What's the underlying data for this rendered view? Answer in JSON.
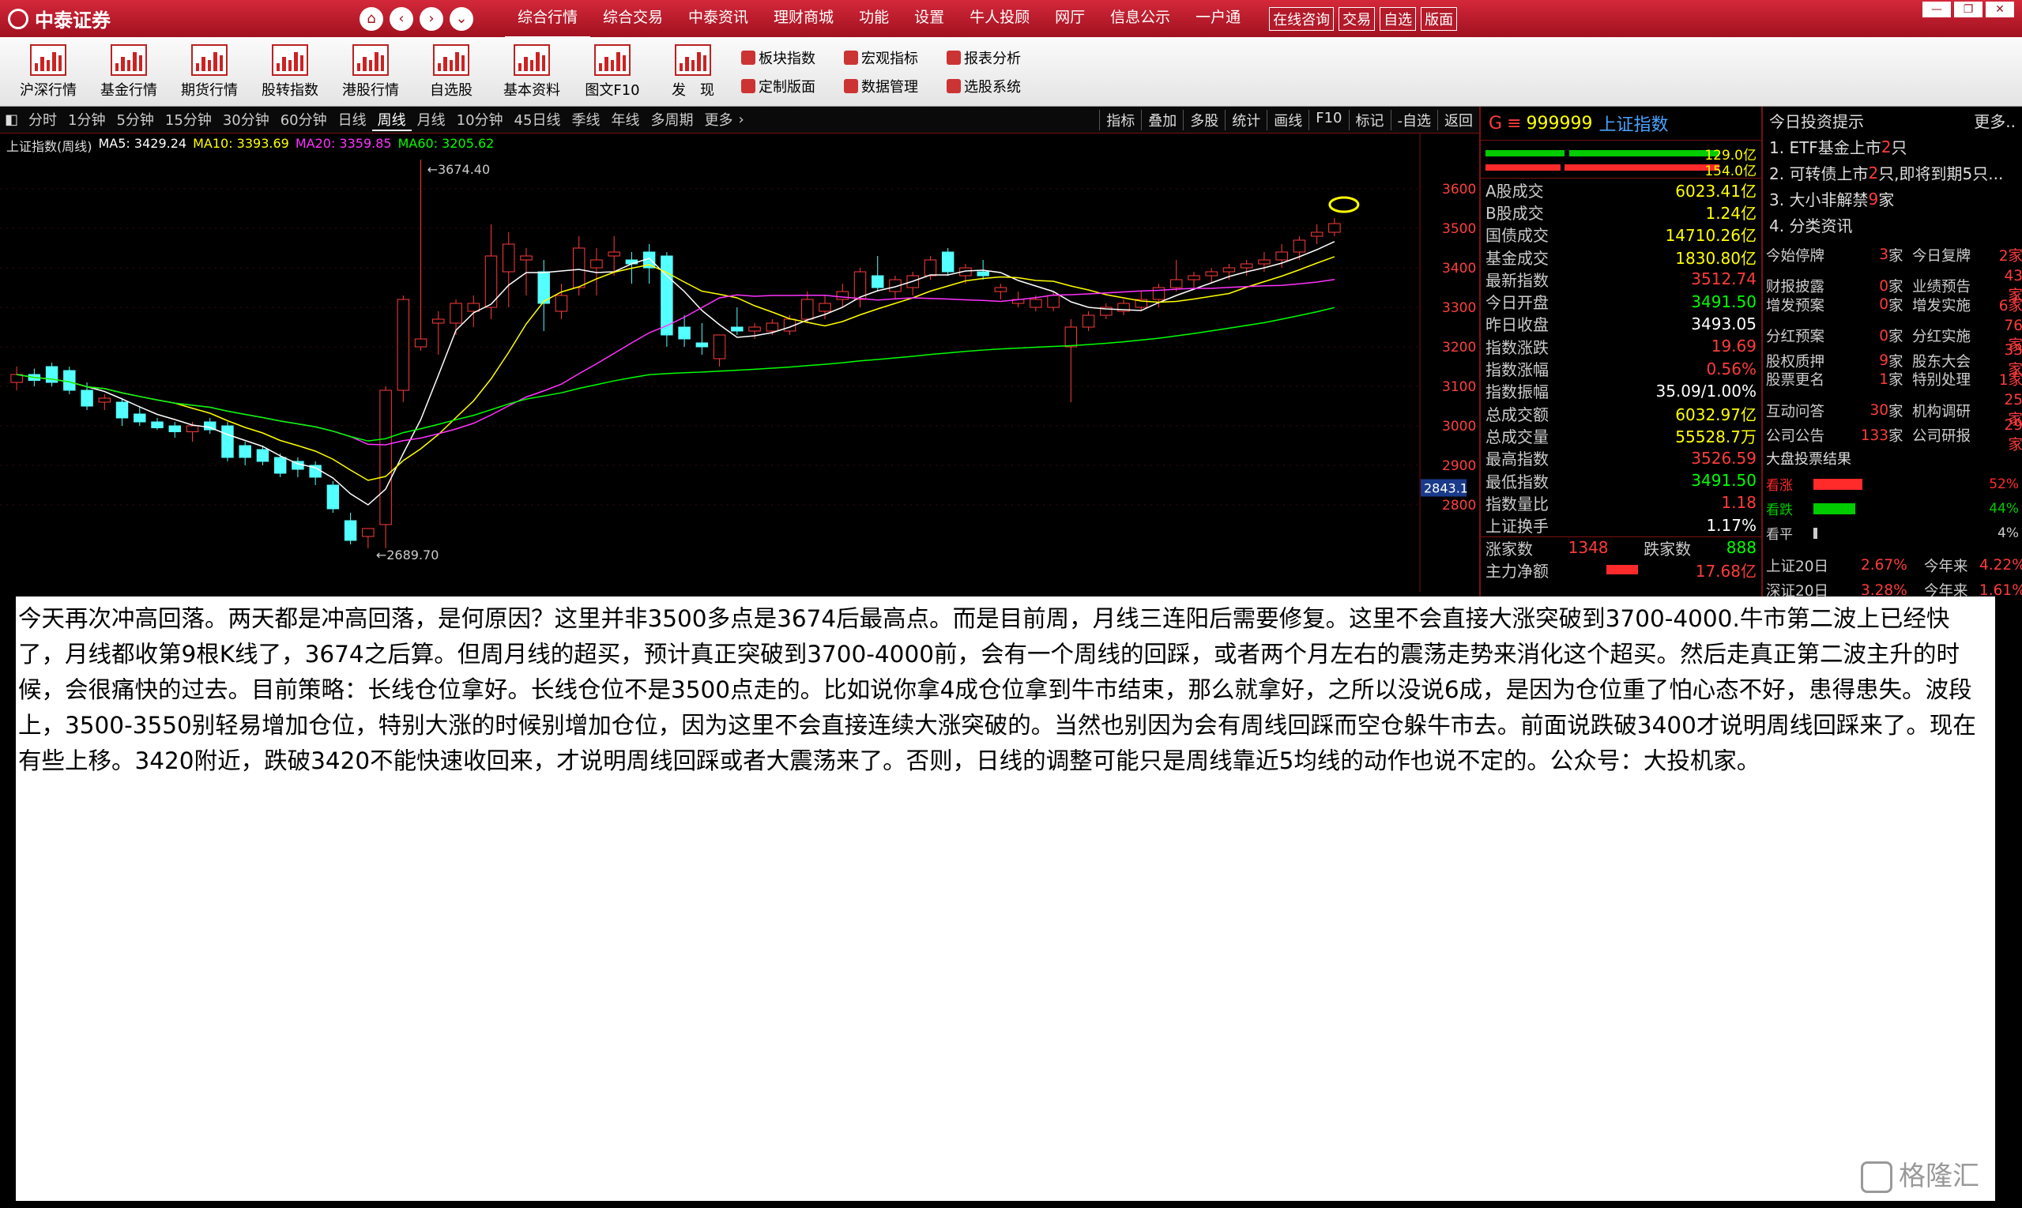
{
  "app": {
    "name": "中泰证券"
  },
  "nav_icons": [
    "home-icon",
    "back-icon",
    "forward-icon",
    "dropdown-icon"
  ],
  "top_menu": [
    "综合行情",
    "综合交易",
    "中泰资讯",
    "理财商城",
    "功能",
    "设置",
    "牛人投顾",
    "网厅",
    "信息公示",
    "一户通"
  ],
  "top_buttons": [
    "在线咨询",
    "交易",
    "自选",
    "版面"
  ],
  "toolbar": {
    "items": [
      "沪深行情",
      "基金行情",
      "期货行情",
      "股转指数",
      "港股行情",
      "自选股",
      "基本资料",
      "图文F10",
      "发　现"
    ],
    "grid": [
      "板块指数",
      "宏观指标",
      "报表分析",
      "定制版面",
      "数据管理",
      "选股系统"
    ]
  },
  "periods": [
    "分时",
    "1分钟",
    "5分钟",
    "15分钟",
    "30分钟",
    "60分钟",
    "日线",
    "周线",
    "月线",
    "10分钟",
    "45日线",
    "季线",
    "年线",
    "多周期",
    "更多"
  ],
  "active_period": "周线",
  "chart_tools": [
    "指标",
    "叠加",
    "多股",
    "统计",
    "画线",
    "F10",
    "标记",
    "-自选",
    "返回"
  ],
  "chart_header": {
    "name": "上证指数(周线)",
    "ma5": "MA5: 3429.24",
    "ma10": "MA10: 3393.69",
    "ma20": "MA20: 3359.85",
    "ma60": "MA60: 3205.62"
  },
  "price_axis": [
    "3600",
    "3500",
    "3400",
    "3300",
    "3200",
    "3100",
    "3000",
    "2900",
    "2800"
  ],
  "price_marker": "2843.1",
  "high_label": "3674.40",
  "low_label": "2689.70",
  "quote": {
    "code": "999999",
    "name": "上证指数",
    "buy_val": "129.0亿",
    "sell_val": "154.0亿",
    "rows": [
      {
        "k": "A股成交",
        "v": "6023.41亿",
        "c": "#ffff00"
      },
      {
        "k": "B股成交",
        "v": "1.24亿",
        "c": "#ffff00"
      },
      {
        "k": "国债成交",
        "v": "14710.26亿",
        "c": "#ffff00"
      },
      {
        "k": "基金成交",
        "v": "1830.80亿",
        "c": "#ffff00"
      },
      {
        "k": "最新指数",
        "v": "3512.74",
        "c": "#ff3b3b"
      },
      {
        "k": "今日开盘",
        "v": "3491.50",
        "c": "#00ff00"
      },
      {
        "k": "昨日收盘",
        "v": "3493.05",
        "c": "#ffffff"
      },
      {
        "k": "指数涨跌",
        "v": "19.69",
        "c": "#ff3b3b"
      },
      {
        "k": "指数涨幅",
        "v": "0.56%",
        "c": "#ff3b3b"
      },
      {
        "k": "指数振幅",
        "v": "35.09/1.00%",
        "c": "#ffffff"
      },
      {
        "k": "总成交额",
        "v": "6032.97亿",
        "c": "#ffff00"
      },
      {
        "k": "总成交量",
        "v": "55528.7万",
        "c": "#ffff00"
      },
      {
        "k": "最高指数",
        "v": "3526.59",
        "c": "#ff3b3b"
      },
      {
        "k": "最低指数",
        "v": "3491.50",
        "c": "#00ff00"
      },
      {
        "k": "指数量比",
        "v": "1.18",
        "c": "#ff3b3b"
      },
      {
        "k": "上证换手",
        "v": "1.17%",
        "c": "#ffffff"
      }
    ],
    "up_label": "涨家数",
    "up": "1348",
    "down_label": "跌家数",
    "down": "888",
    "flow_label": "主力净额",
    "flow": "17.68亿"
  },
  "info": {
    "title": "今日投资提示",
    "more": "更多..",
    "tips": [
      {
        "a": "1. ETF基金上市",
        "n": "2",
        "b": "只"
      },
      {
        "a": "2. 可转债上市",
        "n": "2",
        "b": "只,即将到期5只..."
      },
      {
        "a": "3. 大小非解禁 ",
        "n": "9",
        "b": "家"
      },
      {
        "a": "4. 分类资讯",
        "n": "",
        "b": ""
      }
    ],
    "stats": [
      [
        "今始停牌",
        "3",
        "家",
        "今日复牌",
        "2家"
      ],
      [
        "财报披露",
        "0",
        "家",
        "业绩预告",
        "43家"
      ],
      [
        "增发预案",
        "0",
        "家",
        "增发实施",
        "6家"
      ],
      [
        "分红预案",
        "0",
        "家",
        "分红实施",
        "76家"
      ],
      [
        "股权质押",
        "9",
        "家",
        "股东大会",
        "33家"
      ],
      [
        "股票更名",
        "1",
        "家",
        "特别处理",
        "1家"
      ],
      [
        "互动问答",
        "30",
        "家",
        "机构调研",
        "25家"
      ],
      [
        "公司公告",
        "133",
        "家",
        "公司研报",
        "29家"
      ]
    ],
    "vote_title": "大盘投票结果",
    "votes": [
      {
        "k": "看涨",
        "v": "52%",
        "pct": 0.52,
        "color": "#ff2a2a"
      },
      {
        "k": "看跌",
        "v": "44%",
        "pct": 0.44,
        "color": "#00cc00"
      },
      {
        "k": "看平",
        "v": "4%",
        "pct": 0.04,
        "color": "#cccccc"
      }
    ],
    "bottom": [
      {
        "k": "上证20日",
        "v": "2.67%",
        "k2": "今年来",
        "v2": "4.22%"
      },
      {
        "k": "深证20日",
        "v": "3.28%",
        "k2": "今年来",
        "v2": "1.61%"
      }
    ]
  },
  "article": "今天再次冲高回落。两天都是冲高回落，是何原因？这里并非3500多点是3674后最高点。而是目前周，月线三连阳后需要修复。这里不会直接大涨突破到3700-4000.牛市第二波上已经快了，月线都收第9根K线了，3674之后算。但周月线的超买，预计真正突破到3700-4000前，会有一个周线的回踩，或者两个月左右的震荡走势来消化这个超买。然后走真正第二波主升的时候，会很痛快的过去。目前策略：长线仓位拿好。长线仓位不是3500点走的。比如说你拿4成仓位拿到牛市结束，那么就拿好，之所以没说6成，是因为仓位重了怕心态不好，患得患失。波段上，3500-3550别轻易增加仓位，特别大涨的时候别增加仓位，因为这里不会直接连续大涨突破的。当然也别因为会有周线回踩而空仓躲牛市去。前面说跌破3400才说明周线回踩来了。现在有些上移。3420附近，跌破3420不能快速收回来，才说明周线回踩或者大震荡来了。否则，日线的调整可能只是周线靠近5均线的动作也说不定的。公众号：大投机家。",
  "watermark": "格隆汇",
  "chart_data": {
    "type": "candlestick",
    "title": "上证指数(周线)",
    "ylim": [
      2650,
      3700
    ],
    "candles": [
      [
        3110,
        3150,
        3090,
        3130
      ],
      [
        3130,
        3145,
        3100,
        3115
      ],
      [
        3150,
        3160,
        3100,
        3110
      ],
      [
        3140,
        3150,
        3080,
        3090
      ],
      [
        3090,
        3110,
        3040,
        3050
      ],
      [
        3060,
        3080,
        3040,
        3070
      ],
      [
        3060,
        3070,
        3000,
        3020
      ],
      [
        3030,
        3050,
        3000,
        3010
      ],
      [
        3010,
        3020,
        2990,
        2995
      ],
      [
        3000,
        3010,
        2970,
        2985
      ],
      [
        2985,
        3010,
        2960,
        3000
      ],
      [
        3010,
        3020,
        2980,
        2990
      ],
      [
        3000,
        3010,
        2910,
        2920
      ],
      [
        2950,
        2960,
        2900,
        2920
      ],
      [
        2940,
        2950,
        2900,
        2910
      ],
      [
        2920,
        2930,
        2870,
        2880
      ],
      [
        2910,
        2920,
        2870,
        2890
      ],
      [
        2900,
        2910,
        2850,
        2870
      ],
      [
        2850,
        2860,
        2780,
        2790
      ],
      [
        2760,
        2780,
        2700,
        2710
      ],
      [
        2720,
        2740,
        2690,
        2740
      ],
      [
        2750,
        3100,
        2690,
        3090
      ],
      [
        3090,
        3330,
        3060,
        3320
      ],
      [
        3200,
        3674,
        3190,
        3220
      ],
      [
        3260,
        3290,
        3180,
        3270
      ],
      [
        3260,
        3320,
        3230,
        3310
      ],
      [
        3290,
        3330,
        3250,
        3310
      ],
      [
        3300,
        3510,
        3270,
        3430
      ],
      [
        3390,
        3490,
        3300,
        3460
      ],
      [
        3420,
        3450,
        3330,
        3430
      ],
      [
        3390,
        3420,
        3240,
        3310
      ],
      [
        3290,
        3360,
        3270,
        3330
      ],
      [
        3350,
        3480,
        3330,
        3450
      ],
      [
        3400,
        3450,
        3330,
        3420
      ],
      [
        3430,
        3480,
        3380,
        3440
      ],
      [
        3420,
        3440,
        3360,
        3410
      ],
      [
        3440,
        3460,
        3360,
        3400
      ],
      [
        3430,
        3440,
        3200,
        3230
      ],
      [
        3250,
        3280,
        3200,
        3220
      ],
      [
        3210,
        3260,
        3180,
        3200
      ],
      [
        3170,
        3230,
        3150,
        3230
      ],
      [
        3250,
        3300,
        3230,
        3240
      ],
      [
        3240,
        3260,
        3220,
        3250
      ],
      [
        3240,
        3270,
        3230,
        3260
      ],
      [
        3240,
        3280,
        3230,
        3270
      ],
      [
        3270,
        3340,
        3260,
        3320
      ],
      [
        3290,
        3330,
        3270,
        3310
      ],
      [
        3320,
        3360,
        3300,
        3340
      ],
      [
        3320,
        3400,
        3300,
        3390
      ],
      [
        3380,
        3430,
        3340,
        3350
      ],
      [
        3340,
        3380,
        3320,
        3370
      ],
      [
        3350,
        3390,
        3330,
        3380
      ],
      [
        3380,
        3430,
        3370,
        3420
      ],
      [
        3440,
        3450,
        3380,
        3390
      ],
      [
        3380,
        3410,
        3360,
        3400
      ],
      [
        3390,
        3420,
        3370,
        3380
      ],
      [
        3340,
        3360,
        3320,
        3350
      ],
      [
        3310,
        3340,
        3300,
        3320
      ],
      [
        3300,
        3330,
        3290,
        3320
      ],
      [
        3300,
        3340,
        3290,
        3330
      ],
      [
        3200,
        3270,
        3060,
        3250
      ],
      [
        3250,
        3290,
        3240,
        3280
      ],
      [
        3280,
        3310,
        3270,
        3300
      ],
      [
        3290,
        3320,
        3280,
        3310
      ],
      [
        3300,
        3340,
        3290,
        3320
      ],
      [
        3320,
        3360,
        3300,
        3350
      ],
      [
        3350,
        3420,
        3340,
        3370
      ],
      [
        3370,
        3390,
        3350,
        3380
      ],
      [
        3380,
        3400,
        3360,
        3390
      ],
      [
        3390,
        3410,
        3370,
        3400
      ],
      [
        3400,
        3420,
        3380,
        3410
      ],
      [
        3410,
        3440,
        3390,
        3420
      ],
      [
        3420,
        3460,
        3400,
        3440
      ],
      [
        3440,
        3480,
        3420,
        3470
      ],
      [
        3480,
        3510,
        3460,
        3490
      ],
      [
        3490,
        3526,
        3480,
        3512
      ]
    ],
    "ma_labels": [
      "MA5",
      "MA10",
      "MA20",
      "MA60"
    ],
    "ma_colors": [
      "#ffffff",
      "#ffff00",
      "#ff33ff",
      "#00ff00"
    ]
  }
}
